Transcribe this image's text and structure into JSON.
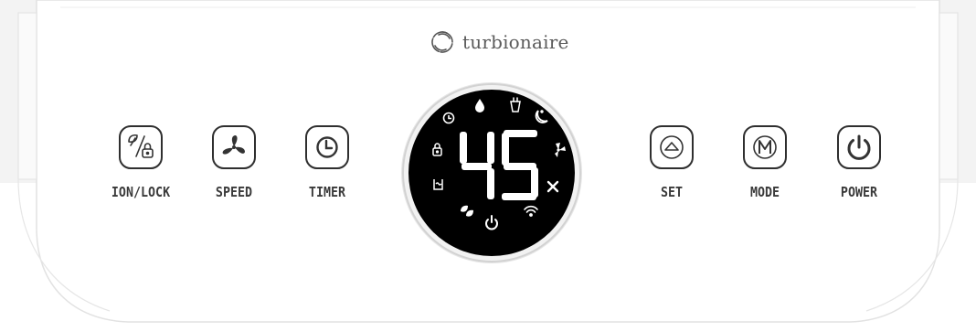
{
  "brand": {
    "name": "turbionaire",
    "logo_icon": "swirl-logo-icon"
  },
  "display": {
    "value": "45"
  },
  "display_icons": [
    "water-drop-icon",
    "tank-icon",
    "clock-icon",
    "sleep-moon-icon",
    "lock-icon",
    "fan-icon",
    "humidity-icon",
    "fan-speed-icon",
    "eco-leaf-icon",
    "power-icon",
    "wifi-icon"
  ],
  "buttons": {
    "ion_lock": {
      "label": "ION/LOCK",
      "icon": "ion-lock-icon"
    },
    "speed": {
      "label": "SPEED",
      "icon": "fan-icon"
    },
    "timer": {
      "label": "TIMER",
      "icon": "clock-icon"
    },
    "set": {
      "label": "SET",
      "icon": "up-triangle-icon"
    },
    "mode": {
      "label": "MODE",
      "icon": "mode-m-icon"
    },
    "power": {
      "label": "POWER",
      "icon": "power-icon"
    }
  },
  "colors": {
    "panel": "#ffffff",
    "display_bg": "#000000",
    "display_fg": "#ffffff",
    "text": "#3a3a3a"
  }
}
